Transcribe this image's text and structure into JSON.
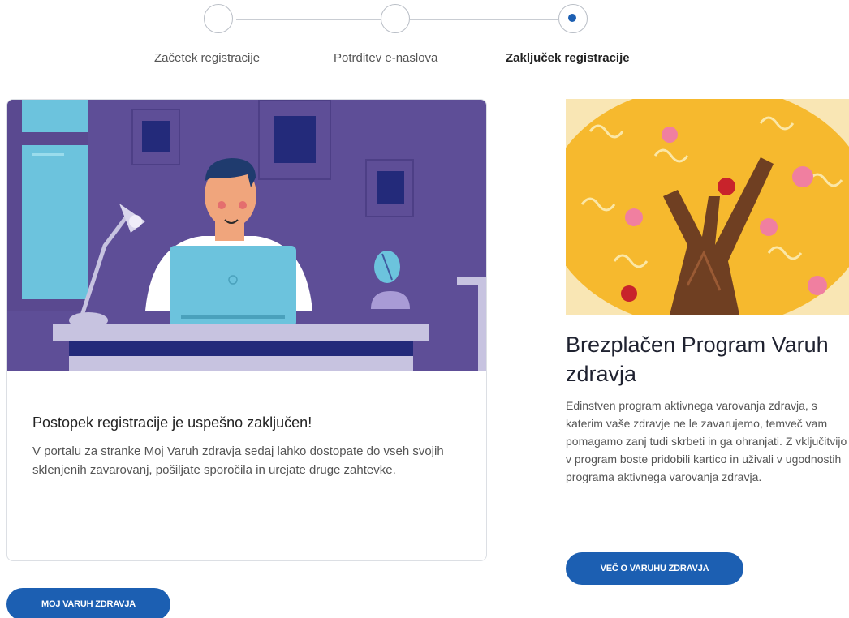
{
  "stepper": {
    "steps": [
      {
        "label": "Začetek registracije",
        "state": "done"
      },
      {
        "label": "Potrditev e-naslova",
        "state": "done"
      },
      {
        "label": "Zaključek registracije",
        "state": "active"
      }
    ]
  },
  "success_card": {
    "title": "Postopek registracije je uspešno zaključen!",
    "text": "V portalu za stranke Moj Varuh zdravja sedaj lahko dostopate do vseh svojih sklenjenih zavarovanj, pošiljate sporočila in urejate druge zahtevke."
  },
  "promo": {
    "title": "Brezplačen Program Varuh zdravja",
    "text": "Edinstven program aktivnega varovanja zdravja, s katerim vaše zdravje ne le zavarujemo, temveč vam pomagamo zanj tudi skrbeti in ga ohranjati. Z vključitvijo v program boste pridobili kartico in uživali v ugodnostih programa aktivnega varovanja zdravja.",
    "button_label": "VEČ O VARUHU ZDRAVJA"
  },
  "main_button_label": "MOJ VARUH ZDRAVJA",
  "colors": {
    "accent": "#1c5fb2",
    "illustration_bg": "#5e4e97",
    "tree_bg": "#f6b92e"
  }
}
